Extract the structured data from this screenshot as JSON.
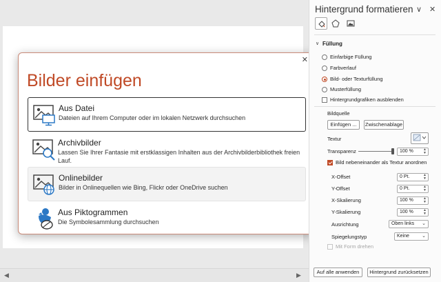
{
  "dialog": {
    "title": "Bilder einfügen",
    "close_glyph": "✕",
    "options": [
      {
        "title": "Aus Datei",
        "desc": "Dateien auf Ihrem Computer oder im lokalen Netzwerk durchsuchen",
        "icon": "file-picture-icon",
        "state": "selected"
      },
      {
        "title": "Archivbilder",
        "desc": "Lassen Sie Ihrer Fantasie mit erstklassigen Inhalten aus der Archivbilderbibliothek freien Lauf.",
        "icon": "stock-images-icon",
        "state": "normal"
      },
      {
        "title": "Onlinebilder",
        "desc": "Bilder in Onlinequellen wie Bing, Flickr oder OneDrive suchen",
        "icon": "online-picture-icon",
        "state": "hovered"
      },
      {
        "title": "Aus Piktogrammen",
        "desc": "Die Symbolesammlung durchsuchen",
        "icon": "pictogram-icon",
        "state": "normal"
      }
    ]
  },
  "pane": {
    "title": "Hintergrund formatieren",
    "dropdown_glyph": "∨",
    "close_glyph": "✕",
    "tabs": [
      "fill-bucket-icon",
      "pentagon-icon",
      "picture-icon"
    ],
    "section": "Füllung",
    "section_chevron": "∨",
    "fill_options": [
      "Einfarbige Füllung",
      "Farbverlauf",
      "Bild- oder Texturfüllung",
      "Musterfüllung"
    ],
    "fill_selected": 2,
    "hide_graphics": "Hintergrundgrafiken ausblenden",
    "source_label": "Bildquelle",
    "insert_button": "Einfügen ...",
    "clipboard_button": "Zwischenablage",
    "texture_label": "Textur",
    "transparency_label": "Transparenz",
    "transparency_value": "100 %",
    "tile_label": "Bild nebeneinander als Textur anordnen",
    "tile_checked": true,
    "offsets": [
      {
        "label": "X-Offset",
        "value": "0 Pt."
      },
      {
        "label": "Y-Offset",
        "value": "0 Pt."
      },
      {
        "label": "X-Skalierung",
        "value": "100 %"
      },
      {
        "label": "Y-Skalierung",
        "value": "100 %"
      }
    ],
    "alignment_label": "Ausrichtung",
    "alignment_value": "Oben links",
    "mirror_label": "Spiegelungstyp",
    "mirror_value": "Keine",
    "rotate_label": "Mit Form drehen",
    "apply_all_button": "Auf alle anwenden",
    "reset_button": "Hintergrund zurücksetzen"
  },
  "colors": {
    "accent": "#c04a26",
    "icon_blue": "#2b78c5"
  }
}
